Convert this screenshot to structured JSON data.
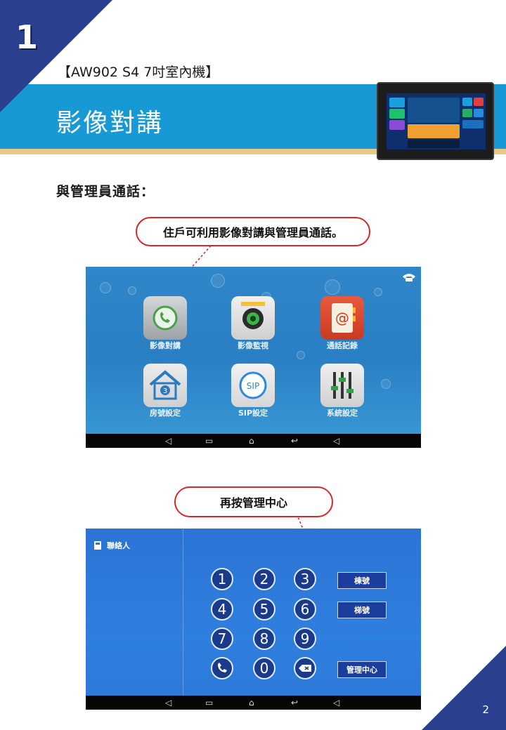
{
  "chapter_number": "1",
  "model_title": "【AW902 S4 7吋室內機】",
  "section_title": "影像對講",
  "subheading": "與管理員通話：",
  "callout1": "住戶可利用影像對講與管理員通話。",
  "callout2": "再按管理中心",
  "home_screen": {
    "apps": [
      {
        "label": "影像對講",
        "icon": "phone-icon"
      },
      {
        "label": "影像監視",
        "icon": "camera-icon"
      },
      {
        "label": "通話記錄",
        "icon": "address-book-icon"
      },
      {
        "label": "房號設定",
        "icon": "house-icon",
        "badge": "3"
      },
      {
        "label": "SIP設定",
        "icon": "sip-icon",
        "badge": "SIP"
      },
      {
        "label": "系統設定",
        "icon": "sliders-icon"
      }
    ]
  },
  "dial_screen": {
    "contacts_label": "聯絡人",
    "keys": [
      "1",
      "2",
      "3",
      "4",
      "5",
      "6",
      "7",
      "8",
      "9",
      "0"
    ],
    "side_buttons": [
      "棟號",
      "梯號",
      "管理中心"
    ]
  },
  "page_number": "2",
  "colors": {
    "brand_navy": "#2b3f8f",
    "band_blue": "#1799d6",
    "accent_red": "#d62828"
  }
}
